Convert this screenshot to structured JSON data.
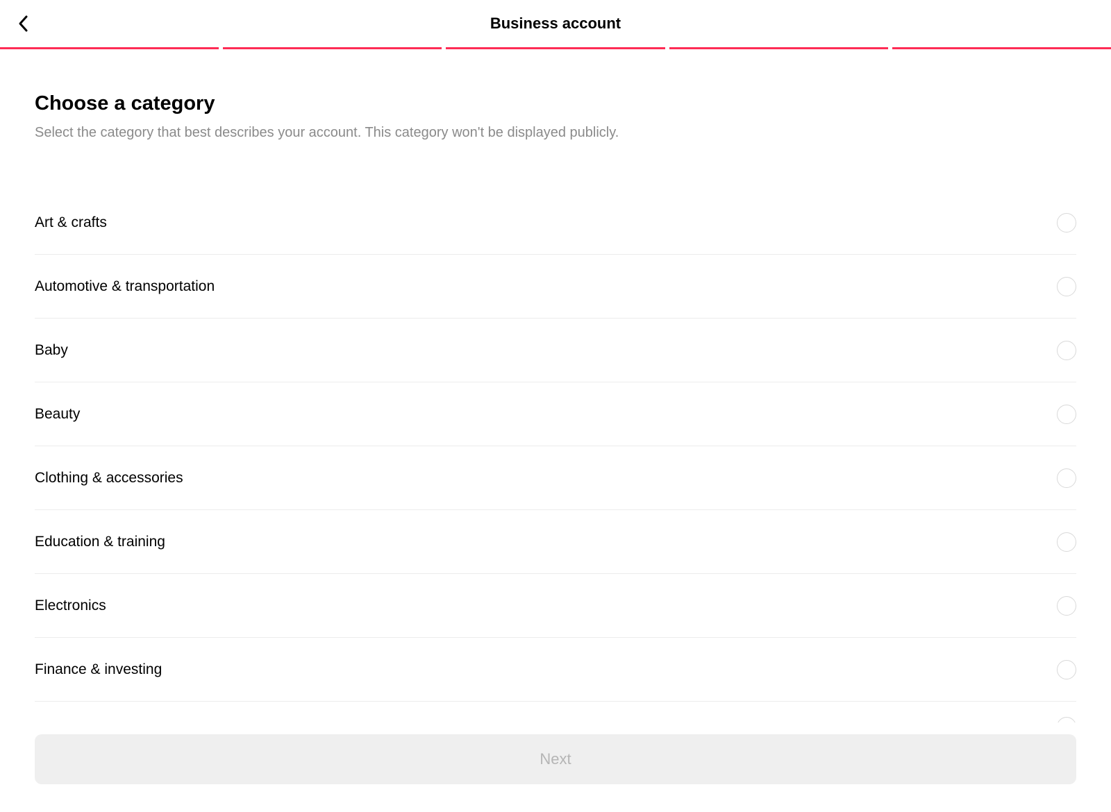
{
  "header": {
    "title": "Business account"
  },
  "content": {
    "heading": "Choose a category",
    "subheading": "Select the category that best describes your account. This category won't be displayed publicly."
  },
  "categories": [
    {
      "label": "Art & crafts"
    },
    {
      "label": "Automotive & transportation"
    },
    {
      "label": "Baby"
    },
    {
      "label": "Beauty"
    },
    {
      "label": "Clothing & accessories"
    },
    {
      "label": "Education & training"
    },
    {
      "label": "Electronics"
    },
    {
      "label": "Finance & investing"
    }
  ],
  "footer": {
    "next_label": "Next"
  },
  "colors": {
    "accent": "#fe2c55"
  }
}
